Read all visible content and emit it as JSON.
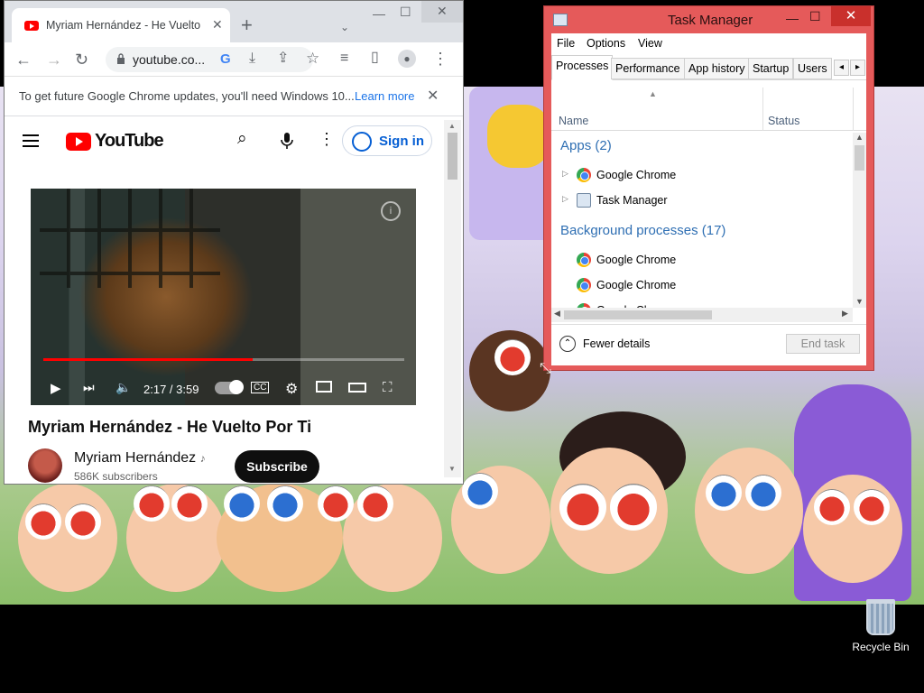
{
  "chrome": {
    "tab_title": "Myriam Hernández - He Vuelto Por Ti",
    "omnibox_url": "youtube.co...",
    "infobar_message": "To get future Google Chrome updates, you'll need Windows 10...",
    "infobar_link": "Learn more"
  },
  "youtube": {
    "logo_text": "YouTube",
    "signin_label": "Sign in",
    "player_time": "2:17 / 3:59",
    "progress_fraction": 0.58,
    "video_title": "Myriam Hernández - He Vuelto Por Ti",
    "channel_name": "Myriam Hernández",
    "subscribers": "586K subscribers",
    "subscribe_label": "Subscribe"
  },
  "taskmanager": {
    "title": "Task Manager",
    "menu": [
      "File",
      "Options",
      "View"
    ],
    "tabs": [
      "Processes",
      "Performance",
      "App history",
      "Startup",
      "Users"
    ],
    "col_name": "Name",
    "col_status": "Status",
    "apps_group": "Apps (2)",
    "apps": [
      "Google Chrome",
      "Task Manager"
    ],
    "bg_group": "Background processes (17)",
    "bg": [
      "Google Chrome",
      "Google Chrome",
      "Google Chrome"
    ],
    "fewer_details": "Fewer details",
    "end_task": "End task"
  },
  "desktop": {
    "recycle_label": "Recycle Bin"
  }
}
